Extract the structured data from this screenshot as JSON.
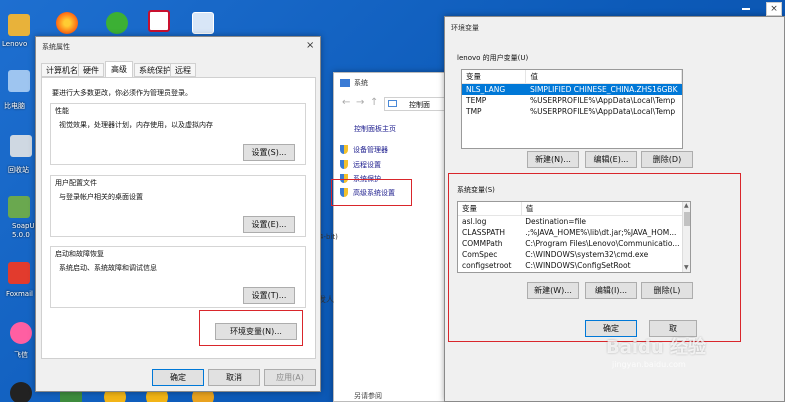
{
  "desktop": {
    "icons": [
      {
        "label": "Lenovo"
      },
      {
        "label": "比电脑"
      },
      {
        "label": "回收站"
      },
      {
        "label": "SoapUI 5.0.0"
      },
      {
        "label": "Foxmail"
      },
      {
        "label": "飞信"
      }
    ]
  },
  "sysprops": {
    "title": "系统属性",
    "tabs": [
      "计算机名",
      "硬件",
      "高级",
      "系统保护",
      "远程"
    ],
    "notice": "要进行大多数更改，你必须作为管理员登录。",
    "performance": {
      "title": "性能",
      "desc": "视觉效果，处理器计划，内存使用，以及虚拟内存",
      "button": "设置(S)..."
    },
    "profiles": {
      "title": "用户配置文件",
      "desc": "与登录帐户相关的桌面设置",
      "button": "设置(E)..."
    },
    "startup": {
      "title": "启动和故障恢复",
      "desc": "系统启动、系统故障和调试信息",
      "button": "设置(T)..."
    },
    "env_button": "环境变量(N)...",
    "ok": "确定",
    "cancel": "取消",
    "apply": "应用(A)"
  },
  "system_window": {
    "title": "系统",
    "address": "控制面",
    "nav_home": "控制面板主页",
    "links": [
      "设备管理器",
      "远程设置",
      "系统保护",
      "高级系统设置"
    ],
    "fragments": {
      "bit": "4-bit)",
      "publish": "发人",
      "see_also": "另请参阅"
    }
  },
  "envvars": {
    "title": "环境变量",
    "user_label": "lenovo 的用户变量(U)",
    "columns": [
      "变量",
      "值"
    ],
    "user_rows": [
      {
        "name": "NLS_LANG",
        "value": "SIMPLIFIED CHINESE_CHINA.ZHS16GBK"
      },
      {
        "name": "TEMP",
        "value": "%USERPROFILE%\\AppData\\Local\\Temp"
      },
      {
        "name": "TMP",
        "value": "%USERPROFILE%\\AppData\\Local\\Temp"
      }
    ],
    "user_buttons": {
      "new": "新建(N)...",
      "edit": "编辑(E)...",
      "delete": "删除(D)"
    },
    "sys_label": "系统变量(S)",
    "sys_rows": [
      {
        "name": "asl.log",
        "value": "Destination=file"
      },
      {
        "name": "CLASSPATH",
        "value": ".;%JAVA_HOME%\\lib\\dt.jar;%JAVA_HOM..."
      },
      {
        "name": "COMMPath",
        "value": "C:\\Program Files\\Lenovo\\Communicatio..."
      },
      {
        "name": "ComSpec",
        "value": "C:\\WINDOWS\\system32\\cmd.exe"
      },
      {
        "name": "configsetroot",
        "value": "C:\\WINDOWS\\ConfigSetRoot"
      }
    ],
    "sys_buttons": {
      "new": "新建(W)...",
      "edit": "编辑(I)...",
      "delete": "删除(L)"
    },
    "ok": "确定",
    "cancel": "取"
  },
  "watermark": {
    "brand": "Baidu 经验",
    "url": "jingyan.baidu.com"
  },
  "colors": {
    "highlight_red": "#d9262b",
    "selection_blue": "#0078d7",
    "desktop_blue": "#1267c8"
  }
}
